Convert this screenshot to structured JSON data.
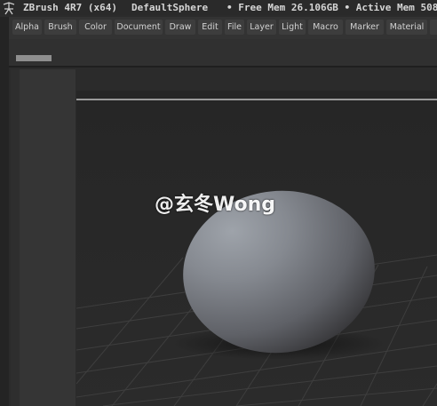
{
  "titlebar": {
    "app_title": "ZBrush 4R7 (x64)",
    "document": "DefaultSphere",
    "memory": "• Free Mem 26.106GB • Active Mem 508"
  },
  "menus": [
    "Alpha",
    "Brush",
    "Color",
    "Document",
    "Draw",
    "Edit",
    "File",
    "Layer",
    "Light",
    "Macro",
    "Marker",
    "Material"
  ],
  "canvas": {
    "object": "sphere-mesh",
    "floor_grid": true,
    "watermark": "@玄冬Wong"
  },
  "colors": {
    "background": "#2b2b2b",
    "menu_button": "#3d3d3d",
    "canvas": "#262626",
    "mesh": "#8a8e94"
  }
}
